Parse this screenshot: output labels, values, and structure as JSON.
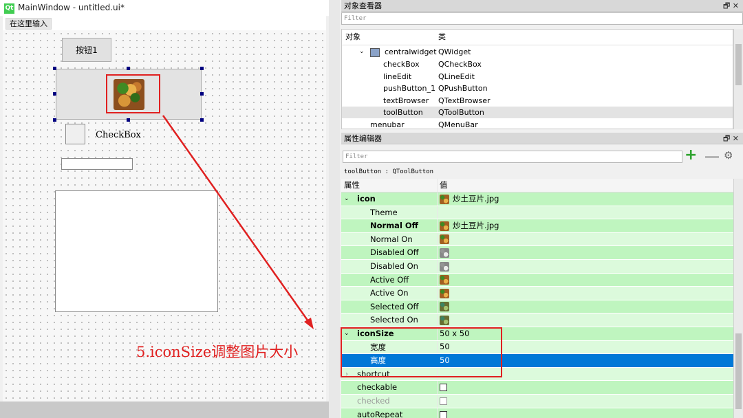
{
  "window": {
    "title": "MainWindow - untitled.ui*",
    "logo_text": "Qt"
  },
  "form": {
    "menu_placeholder": "在这里输入",
    "push_button_label": "按钮1",
    "checkbox_label": "CheckBox"
  },
  "annotation": {
    "text": "5.iconSize调整图片大小",
    "color": "#e02020"
  },
  "object_inspector": {
    "title": "对象查看器",
    "filter_placeholder": "Filter",
    "col_object": "对象",
    "col_class": "类",
    "rows": [
      {
        "name": "centralwidget",
        "cls": "QWidget"
      },
      {
        "name": "checkBox",
        "cls": "QCheckBox"
      },
      {
        "name": "lineEdit",
        "cls": "QLineEdit"
      },
      {
        "name": "pushButton_1",
        "cls": "QPushButton"
      },
      {
        "name": "textBrowser",
        "cls": "QTextBrowser"
      },
      {
        "name": "toolButton",
        "cls": "QToolButton"
      },
      {
        "name": "menubar",
        "cls": "QMenuBar"
      }
    ]
  },
  "property_editor": {
    "title": "属性编辑器",
    "filter_placeholder": "Filter",
    "context": "toolButton : QToolButton",
    "col_property": "属性",
    "col_value": "值",
    "rows": [
      {
        "name": "icon",
        "value": "炒土豆片.jpg"
      },
      {
        "name": "Theme",
        "value": ""
      },
      {
        "name": "Normal Off",
        "value": "炒土豆片.jpg"
      },
      {
        "name": "Normal On",
        "value": ""
      },
      {
        "name": "Disabled Off",
        "value": ""
      },
      {
        "name": "Disabled On",
        "value": ""
      },
      {
        "name": "Active Off",
        "value": ""
      },
      {
        "name": "Active On",
        "value": ""
      },
      {
        "name": "Selected Off",
        "value": ""
      },
      {
        "name": "Selected On",
        "value": ""
      },
      {
        "name": "iconSize",
        "value": "50 x 50"
      },
      {
        "name": "宽度",
        "value": "50"
      },
      {
        "name": "高度",
        "value": "50"
      },
      {
        "name": "shortcut",
        "value": ""
      },
      {
        "name": "checkable",
        "value": ""
      },
      {
        "name": "checked",
        "value": ""
      },
      {
        "name": "autoRepeat",
        "value": ""
      }
    ]
  },
  "colors": {
    "row_green": "#bff5bf",
    "row_light": "#dcfadc",
    "selection": "#0078d7"
  }
}
